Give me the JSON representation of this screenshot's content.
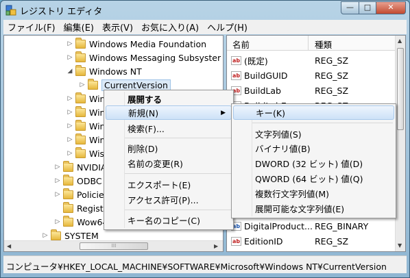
{
  "window": {
    "title": "レジストリ エディタ",
    "buttons": {
      "minimize": "—",
      "maximize": "□",
      "close": "✕"
    }
  },
  "menubar": [
    "ファイル(F)",
    "編集(E)",
    "表示(V)",
    "お気に入り(A)",
    "ヘルプ(H)"
  ],
  "tree": [
    "Windows Media Foundation",
    "Windows Messaging Subsyster",
    "Windows NT",
    "CurrentVersion",
    "Wind",
    "Wind",
    "Wind",
    "Wind",
    "Wisp",
    "NVIDIA",
    "ODBC",
    "Policies",
    "Registe",
    "Wow64",
    "SYSTEM"
  ],
  "list": {
    "columns": {
      "name": "名前",
      "type": "種類"
    },
    "rows": [
      {
        "name": "(既定)",
        "type": "REG_SZ"
      },
      {
        "name": "BuildGUID",
        "type": "REG_SZ"
      },
      {
        "name": "BuildLab",
        "type": "REG_SZ"
      },
      {
        "name": "BuildLabEx",
        "type": "REG_SZ"
      },
      {
        "name": "DigitalProduct...",
        "type": "REG_BINARY"
      },
      {
        "name": "EditionID",
        "type": "REG_SZ"
      }
    ],
    "reg_icon_text": "ab"
  },
  "context_menu": {
    "expand": "展開する",
    "new": "新規(N)",
    "find": "検索(F)...",
    "delete": "削除(D)",
    "rename": "名前の変更(R)",
    "export": "エクスポート(E)",
    "permissions": "アクセス許可(P)...",
    "copy_key_name": "キー名のコピー(C)",
    "submenu_arrow": "▶"
  },
  "submenu": {
    "key": "キー(K)",
    "string": "文字列値(S)",
    "binary": "バイナリ値(B)",
    "dword": "DWORD (32 ビット) 値(D)",
    "qword": "QWORD (64 ビット) 値(Q)",
    "multi_string": "複数行文字列値(M)",
    "expandable_string": "展開可能な文字列値(E)"
  },
  "statusbar": "コンピュータ¥HKEY_LOCAL_MACHINE¥SOFTWARE¥Microsoft¥Windows NT¥CurrentVersion",
  "scroll": {
    "h_thumb": "⁞⁞⁞"
  }
}
